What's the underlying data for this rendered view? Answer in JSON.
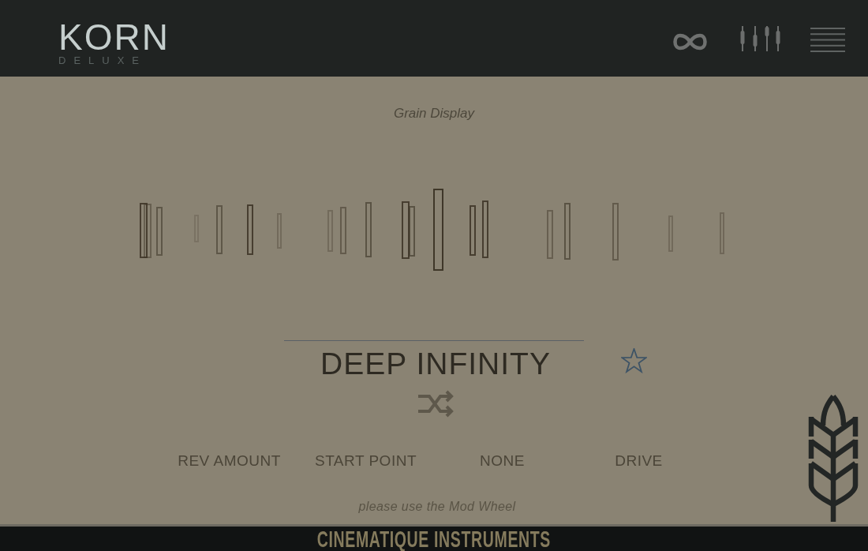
{
  "header": {
    "logo": {
      "title": "KORN",
      "subtitle": "DELUXE"
    }
  },
  "grain_display": {
    "title": "Grain Display"
  },
  "preset": {
    "name": "DEEP INFINITY",
    "favorite": false
  },
  "macros": [
    "REV AMOUNT",
    "START POINT",
    "NONE",
    "DRIVE"
  ],
  "hint": "please use the Mod Wheel",
  "footer": {
    "brand": "CINEMATIQUE INSTRUMENTS"
  }
}
